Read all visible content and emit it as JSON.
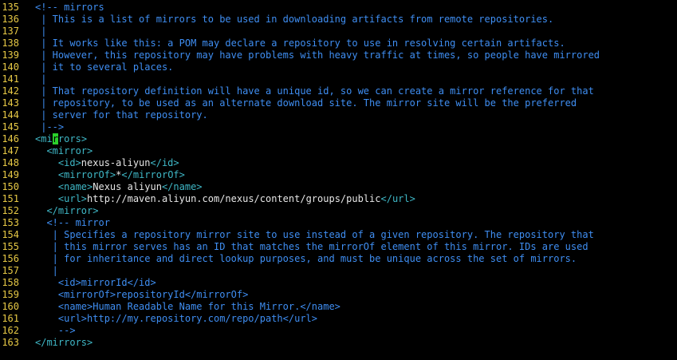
{
  "editor": {
    "language": "xml",
    "cursor": {
      "line": 146,
      "column": 6,
      "char": "r"
    },
    "colors": {
      "background": "#000000",
      "line_number": "#e6c845",
      "comment": "#3f8ef2",
      "tag": "#3fb8c7",
      "text": "#e6e6e6",
      "cursor": "#2bd12b"
    },
    "lines": [
      {
        "n": "135",
        "tokens": [
          {
            "t": "comment",
            "v": "<!-- mirrors"
          }
        ]
      },
      {
        "n": "136",
        "tokens": [
          {
            "t": "comment",
            "v": " | This is a list of mirrors to be used in downloading artifacts from remote repositories."
          }
        ]
      },
      {
        "n": "137",
        "tokens": [
          {
            "t": "comment",
            "v": " |"
          }
        ]
      },
      {
        "n": "138",
        "tokens": [
          {
            "t": "comment",
            "v": " | It works like this: a POM may declare a repository to use in resolving certain artifacts."
          }
        ]
      },
      {
        "n": "139",
        "tokens": [
          {
            "t": "comment",
            "v": " | However, this repository may have problems with heavy traffic at times, so people have mirrored"
          }
        ]
      },
      {
        "n": "140",
        "tokens": [
          {
            "t": "comment",
            "v": " | it to several places."
          }
        ]
      },
      {
        "n": "141",
        "tokens": [
          {
            "t": "comment",
            "v": " |"
          }
        ]
      },
      {
        "n": "142",
        "tokens": [
          {
            "t": "comment",
            "v": " | That repository definition will have a unique id, so we can create a mirror reference for that"
          }
        ]
      },
      {
        "n": "143",
        "tokens": [
          {
            "t": "comment",
            "v": " | repository, to be used as an alternate download site. The mirror site will be the preferred"
          }
        ]
      },
      {
        "n": "144",
        "tokens": [
          {
            "t": "comment",
            "v": " | server for that repository."
          }
        ]
      },
      {
        "n": "145",
        "tokens": [
          {
            "t": "comment",
            "v": " |-->"
          }
        ]
      },
      {
        "n": "146",
        "tokens": [
          {
            "t": "tag",
            "v": "<mi"
          },
          {
            "t": "cursor",
            "v": "r"
          },
          {
            "t": "tag",
            "v": "rors>"
          }
        ]
      },
      {
        "n": "147",
        "tokens": [
          {
            "t": "tag",
            "v": "  <mirror>"
          }
        ]
      },
      {
        "n": "148",
        "tokens": [
          {
            "t": "tag",
            "v": "    <id>"
          },
          {
            "t": "text",
            "v": "nexus-aliyun"
          },
          {
            "t": "tag",
            "v": "</id>"
          }
        ]
      },
      {
        "n": "149",
        "tokens": [
          {
            "t": "tag",
            "v": "    <mirrorOf>"
          },
          {
            "t": "text",
            "v": "*"
          },
          {
            "t": "tag",
            "v": "</mirrorOf>"
          }
        ]
      },
      {
        "n": "150",
        "tokens": [
          {
            "t": "tag",
            "v": "    <name>"
          },
          {
            "t": "text",
            "v": "Nexus aliyun"
          },
          {
            "t": "tag",
            "v": "</name>"
          }
        ]
      },
      {
        "n": "151",
        "tokens": [
          {
            "t": "tag",
            "v": "    <url>"
          },
          {
            "t": "text",
            "v": "http://maven.aliyun.com/nexus/content/groups/public"
          },
          {
            "t": "tag",
            "v": "</url>"
          }
        ]
      },
      {
        "n": "152",
        "tokens": [
          {
            "t": "tag",
            "v": "  </mirror>"
          }
        ]
      },
      {
        "n": "153",
        "tokens": [
          {
            "t": "comment",
            "v": "  <!-- mirror"
          }
        ]
      },
      {
        "n": "154",
        "tokens": [
          {
            "t": "comment",
            "v": "   | Specifies a repository mirror site to use instead of a given repository. The repository that"
          }
        ]
      },
      {
        "n": "155",
        "tokens": [
          {
            "t": "comment",
            "v": "   | this mirror serves has an ID that matches the mirrorOf element of this mirror. IDs are used"
          }
        ]
      },
      {
        "n": "156",
        "tokens": [
          {
            "t": "comment",
            "v": "   | for inheritance and direct lookup purposes, and must be unique across the set of mirrors."
          }
        ]
      },
      {
        "n": "157",
        "tokens": [
          {
            "t": "comment",
            "v": "   |"
          }
        ]
      },
      {
        "n": "158",
        "tokens": [
          {
            "t": "comment",
            "v": "    <id>mirrorId</id>"
          }
        ]
      },
      {
        "n": "159",
        "tokens": [
          {
            "t": "comment",
            "v": "    <mirrorOf>repositoryId</mirrorOf>"
          }
        ]
      },
      {
        "n": "160",
        "tokens": [
          {
            "t": "comment",
            "v": "    <name>Human Readable Name for this Mirror.</name>"
          }
        ]
      },
      {
        "n": "161",
        "tokens": [
          {
            "t": "comment",
            "v": "    <url>http://my.repository.com/repo/path</url>"
          }
        ]
      },
      {
        "n": "162",
        "tokens": [
          {
            "t": "comment",
            "v": "    -->"
          }
        ]
      },
      {
        "n": "163",
        "tokens": [
          {
            "t": "tag",
            "v": "</mirrors>"
          }
        ]
      }
    ]
  }
}
